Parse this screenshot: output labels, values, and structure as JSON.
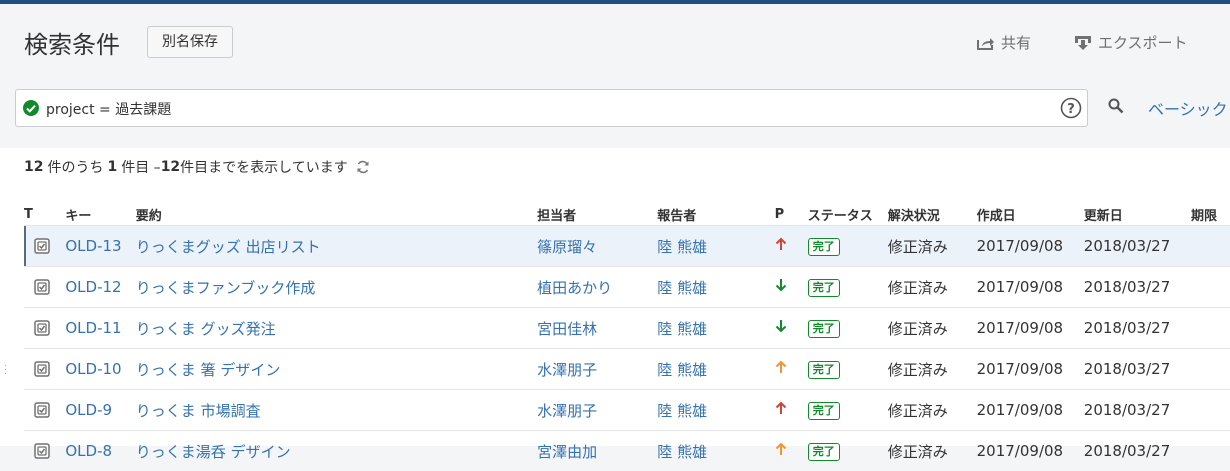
{
  "header": {
    "title": "検索条件",
    "save_as": "別名保存",
    "share": "共有",
    "export": "エクスポート"
  },
  "query": {
    "text": "project = 過去課題",
    "basic_link": "ベーシック"
  },
  "results": {
    "total": "12",
    "prefix": "件のうち",
    "start": "1",
    "middle": "件目 – ",
    "end": "12",
    "suffix": "件目までを表示しています"
  },
  "columns": {
    "t": "T",
    "key": "キー",
    "summary": "要約",
    "assignee": "担当者",
    "reporter": "報告者",
    "priority": "P",
    "status": "ステータス",
    "resolution": "解決状況",
    "created": "作成日",
    "updated": "更新日",
    "due": "期限"
  },
  "colors": {
    "priority_high": "#d04437",
    "priority_medium": "#f79232",
    "priority_low": "#14892c",
    "link": "#3572b0",
    "status_done": "#14892c"
  },
  "rows": [
    {
      "key": "OLD-13",
      "summary": "りっくまグッズ 出店リスト",
      "assignee": "篠原瑠々",
      "reporter": "陸 熊雄",
      "priority": "high",
      "status": "完了",
      "resolution": "修正済み",
      "created": "2017/09/08",
      "updated": "2018/03/27"
    },
    {
      "key": "OLD-12",
      "summary": "りっくまファンブック作成",
      "assignee": "植田あかり",
      "reporter": "陸 熊雄",
      "priority": "low",
      "status": "完了",
      "resolution": "修正済み",
      "created": "2017/09/08",
      "updated": "2018/03/27"
    },
    {
      "key": "OLD-11",
      "summary": "りっくま グッズ発注",
      "assignee": "宮田佳林",
      "reporter": "陸 熊雄",
      "priority": "low",
      "status": "完了",
      "resolution": "修正済み",
      "created": "2017/09/08",
      "updated": "2018/03/27"
    },
    {
      "key": "OLD-10",
      "summary": "りっくま 箸 デザイン",
      "assignee": "水澤朋子",
      "reporter": "陸 熊雄",
      "priority": "medium",
      "status": "完了",
      "resolution": "修正済み",
      "created": "2017/09/08",
      "updated": "2018/03/27"
    },
    {
      "key": "OLD-9",
      "summary": "りっくま 市場調査",
      "assignee": "水澤朋子",
      "reporter": "陸 熊雄",
      "priority": "high",
      "status": "完了",
      "resolution": "修正済み",
      "created": "2017/09/08",
      "updated": "2018/03/27"
    },
    {
      "key": "OLD-8",
      "summary": "りっくま湯呑 デザイン",
      "assignee": "宮澤由加",
      "reporter": "陸 熊雄",
      "priority": "medium",
      "status": "完了",
      "resolution": "修正済み",
      "created": "2017/09/08",
      "updated": "2018/03/27"
    }
  ]
}
